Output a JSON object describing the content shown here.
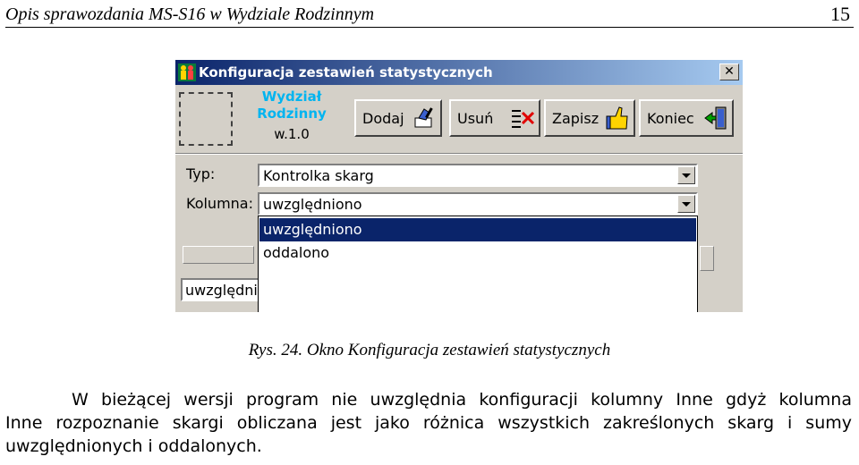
{
  "header": {
    "title": "Opis sprawozdania MS-S16 w Wydziale Rodzinnym",
    "page_number": "15"
  },
  "dialog": {
    "title": "Konfiguracja zestawień statystycznych",
    "app_name_line1": "Wydział",
    "app_name_line2": "Rodzinny",
    "app_version": "w.1.0",
    "buttons": [
      {
        "label": "Dodaj",
        "icon": "hand-pen-icon"
      },
      {
        "label": "Usuń",
        "icon": "delete-x-icon"
      },
      {
        "label": "Zapisz",
        "icon": "thumbs-up-icon"
      },
      {
        "label": "Koniec",
        "icon": "exit-door-icon"
      }
    ],
    "typ_label": "Typ:",
    "typ_value": "Kontrolka skarg",
    "kolumna_label": "Kolumna:",
    "kolumna_value": "uwzględniono",
    "dropdown_options": [
      "uwzględniono",
      "oddalono"
    ],
    "dropdown_selected_index": 0,
    "edit_field_value": "uwzględnio",
    "colors": {
      "titlebar": "#0a246a",
      "app_name": "#00b4f0",
      "selection": "#0a246a",
      "face": "#d4d0c8"
    }
  },
  "caption": "Rys. 24. Okno Konfiguracja zestawień statystycznych",
  "paragraph": {
    "line1": "W bieżącej wersji program nie uwzględnia konfiguracji kolumny Inne gdyż kolumna",
    "line2": "Inne rozpoznanie skargi obliczana jest jako różnica wszystkich zakreślonych skarg i sumy",
    "line3": "uwzględnionych i oddalonych."
  }
}
